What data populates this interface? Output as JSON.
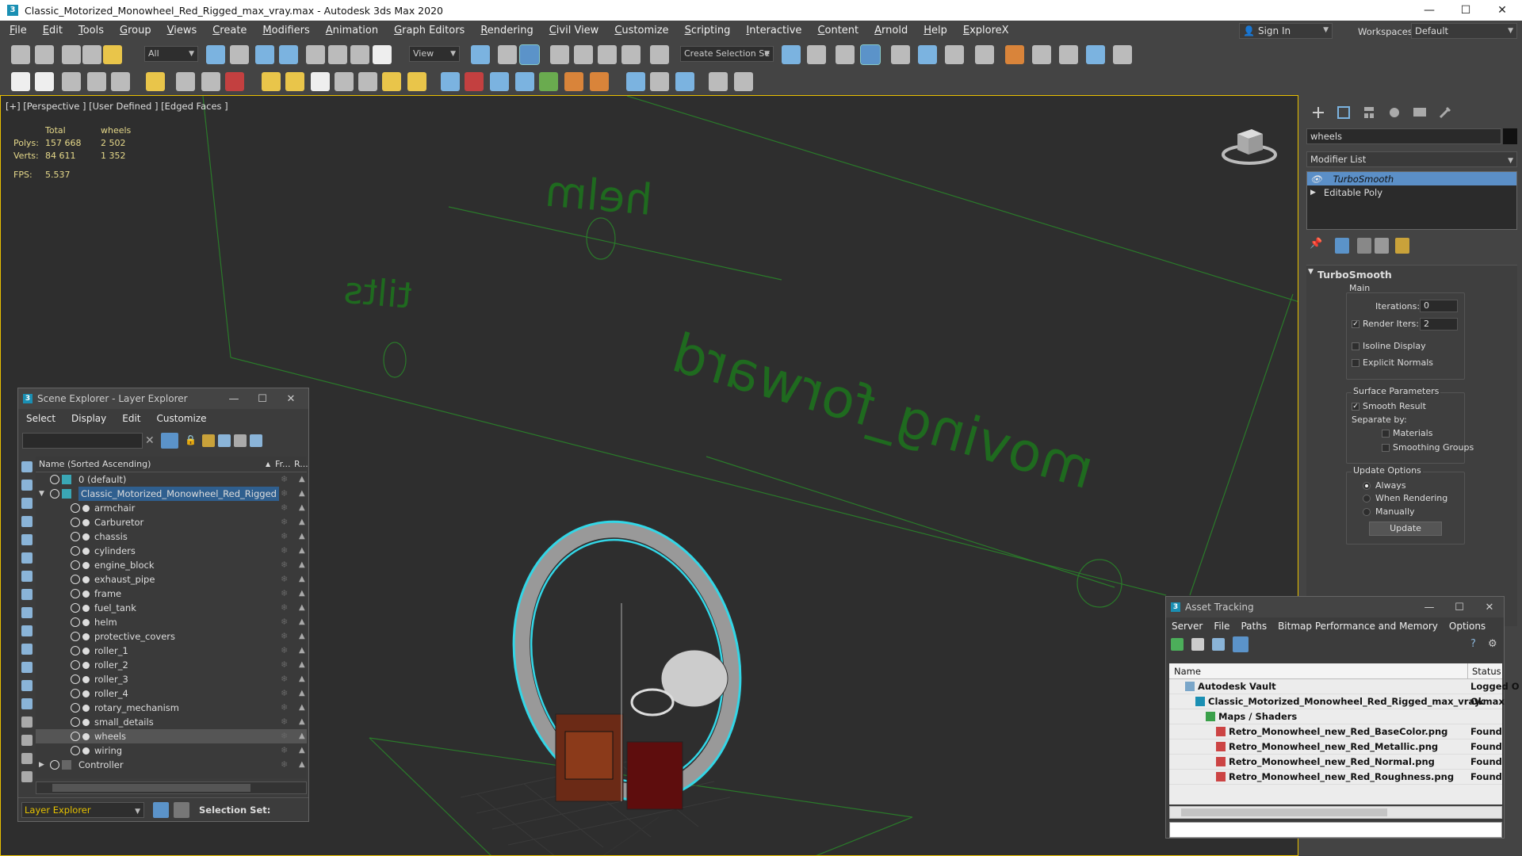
{
  "window": {
    "title": "Classic_Motorized_Monowheel_Red_Rigged_max_vray.max - Autodesk 3ds Max 2020"
  },
  "menu": [
    "File",
    "Edit",
    "Tools",
    "Group",
    "Views",
    "Create",
    "Modifiers",
    "Animation",
    "Graph Editors",
    "Rendering",
    "Civil View",
    "Customize",
    "Scripting",
    "Interactive",
    "Content",
    "Arnold",
    "Help",
    "ExploreX"
  ],
  "account": {
    "signin": "Sign In",
    "workspaces_label": "Workspaces:",
    "workspace": "Default"
  },
  "toolbar": {
    "filter": "All",
    "refcoord": "View",
    "selection_set": "Create Selection Se"
  },
  "viewport": {
    "label": "[+] [Perspective ] [User Defined ] [Edged Faces ]",
    "stats": {
      "col_total": "Total",
      "col_sel": "wheels",
      "polys_label": "Polys:",
      "polys_total": "157 668",
      "polys_sel": "2 502",
      "verts_label": "Verts:",
      "verts_total": "84 611",
      "verts_sel": "1 352",
      "fps_label": "FPS:",
      "fps": "5.537"
    },
    "labels": {
      "helm": "helm",
      "tilts": "tilts",
      "moving": "moving_forward"
    }
  },
  "command_panel": {
    "object_name": "wheels",
    "modifier_list": "Modifier List",
    "stack": [
      "TurboSmooth",
      "Editable Poly"
    ],
    "rollout": {
      "title": "TurboSmooth",
      "main": "Main",
      "iterations_label": "Iterations:",
      "iterations": "0",
      "render_iters_label": "Render Iters:",
      "render_iters": "2",
      "isoline": "Isoline Display",
      "explicit": "Explicit Normals",
      "surface": "Surface Parameters",
      "smooth_result": "Smooth Result",
      "separate_by": "Separate by:",
      "materials": "Materials",
      "smoothing_groups": "Smoothing Groups",
      "update_options": "Update Options",
      "always": "Always",
      "when_rendering": "When Rendering",
      "manually": "Manually",
      "update": "Update"
    }
  },
  "scene_explorer": {
    "title": "Scene Explorer - Layer Explorer",
    "menu": [
      "Select",
      "Display",
      "Edit",
      "Customize"
    ],
    "header_name": "Name (Sorted Ascending)",
    "header_fr": "Fr...",
    "header_r": "R...",
    "default_layer": "0 (default)",
    "root_layer": "Classic_Motorized_Monowheel_Red_Rigged",
    "children": [
      "armchair",
      "Carburetor",
      "chassis",
      "cylinders",
      "engine_block",
      "exhaust_pipe",
      "frame",
      "fuel_tank",
      "helm",
      "protective_covers",
      "roller_1",
      "roller_2",
      "roller_3",
      "roller_4",
      "rotary_mechanism",
      "small_details",
      "wheels",
      "wiring"
    ],
    "controller_layer": "Controller",
    "footer_layer": "Layer Explorer",
    "selection_set_label": "Selection Set:"
  },
  "asset_tracking": {
    "title": "Asset Tracking",
    "menu": [
      "Server",
      "File",
      "Paths",
      "Bitmap Performance and Memory",
      "Options"
    ],
    "col_name": "Name",
    "col_status": "Status",
    "rows": [
      {
        "name": "Autodesk Vault",
        "status": "Logged O",
        "indent": 0
      },
      {
        "name": "Classic_Motorized_Monowheel_Red_Rigged_max_vray.max",
        "status": "Ok",
        "indent": 1
      },
      {
        "name": "Maps / Shaders",
        "status": "",
        "indent": 2
      },
      {
        "name": "Retro_Monowheel_new_Red_BaseColor.png",
        "status": "Found",
        "indent": 3
      },
      {
        "name": "Retro_Monowheel_new_Red_Metallic.png",
        "status": "Found",
        "indent": 3
      },
      {
        "name": "Retro_Monowheel_new_Red_Normal.png",
        "status": "Found",
        "indent": 3
      },
      {
        "name": "Retro_Monowheel_new_Red_Roughness.png",
        "status": "Found",
        "indent": 3
      }
    ]
  }
}
